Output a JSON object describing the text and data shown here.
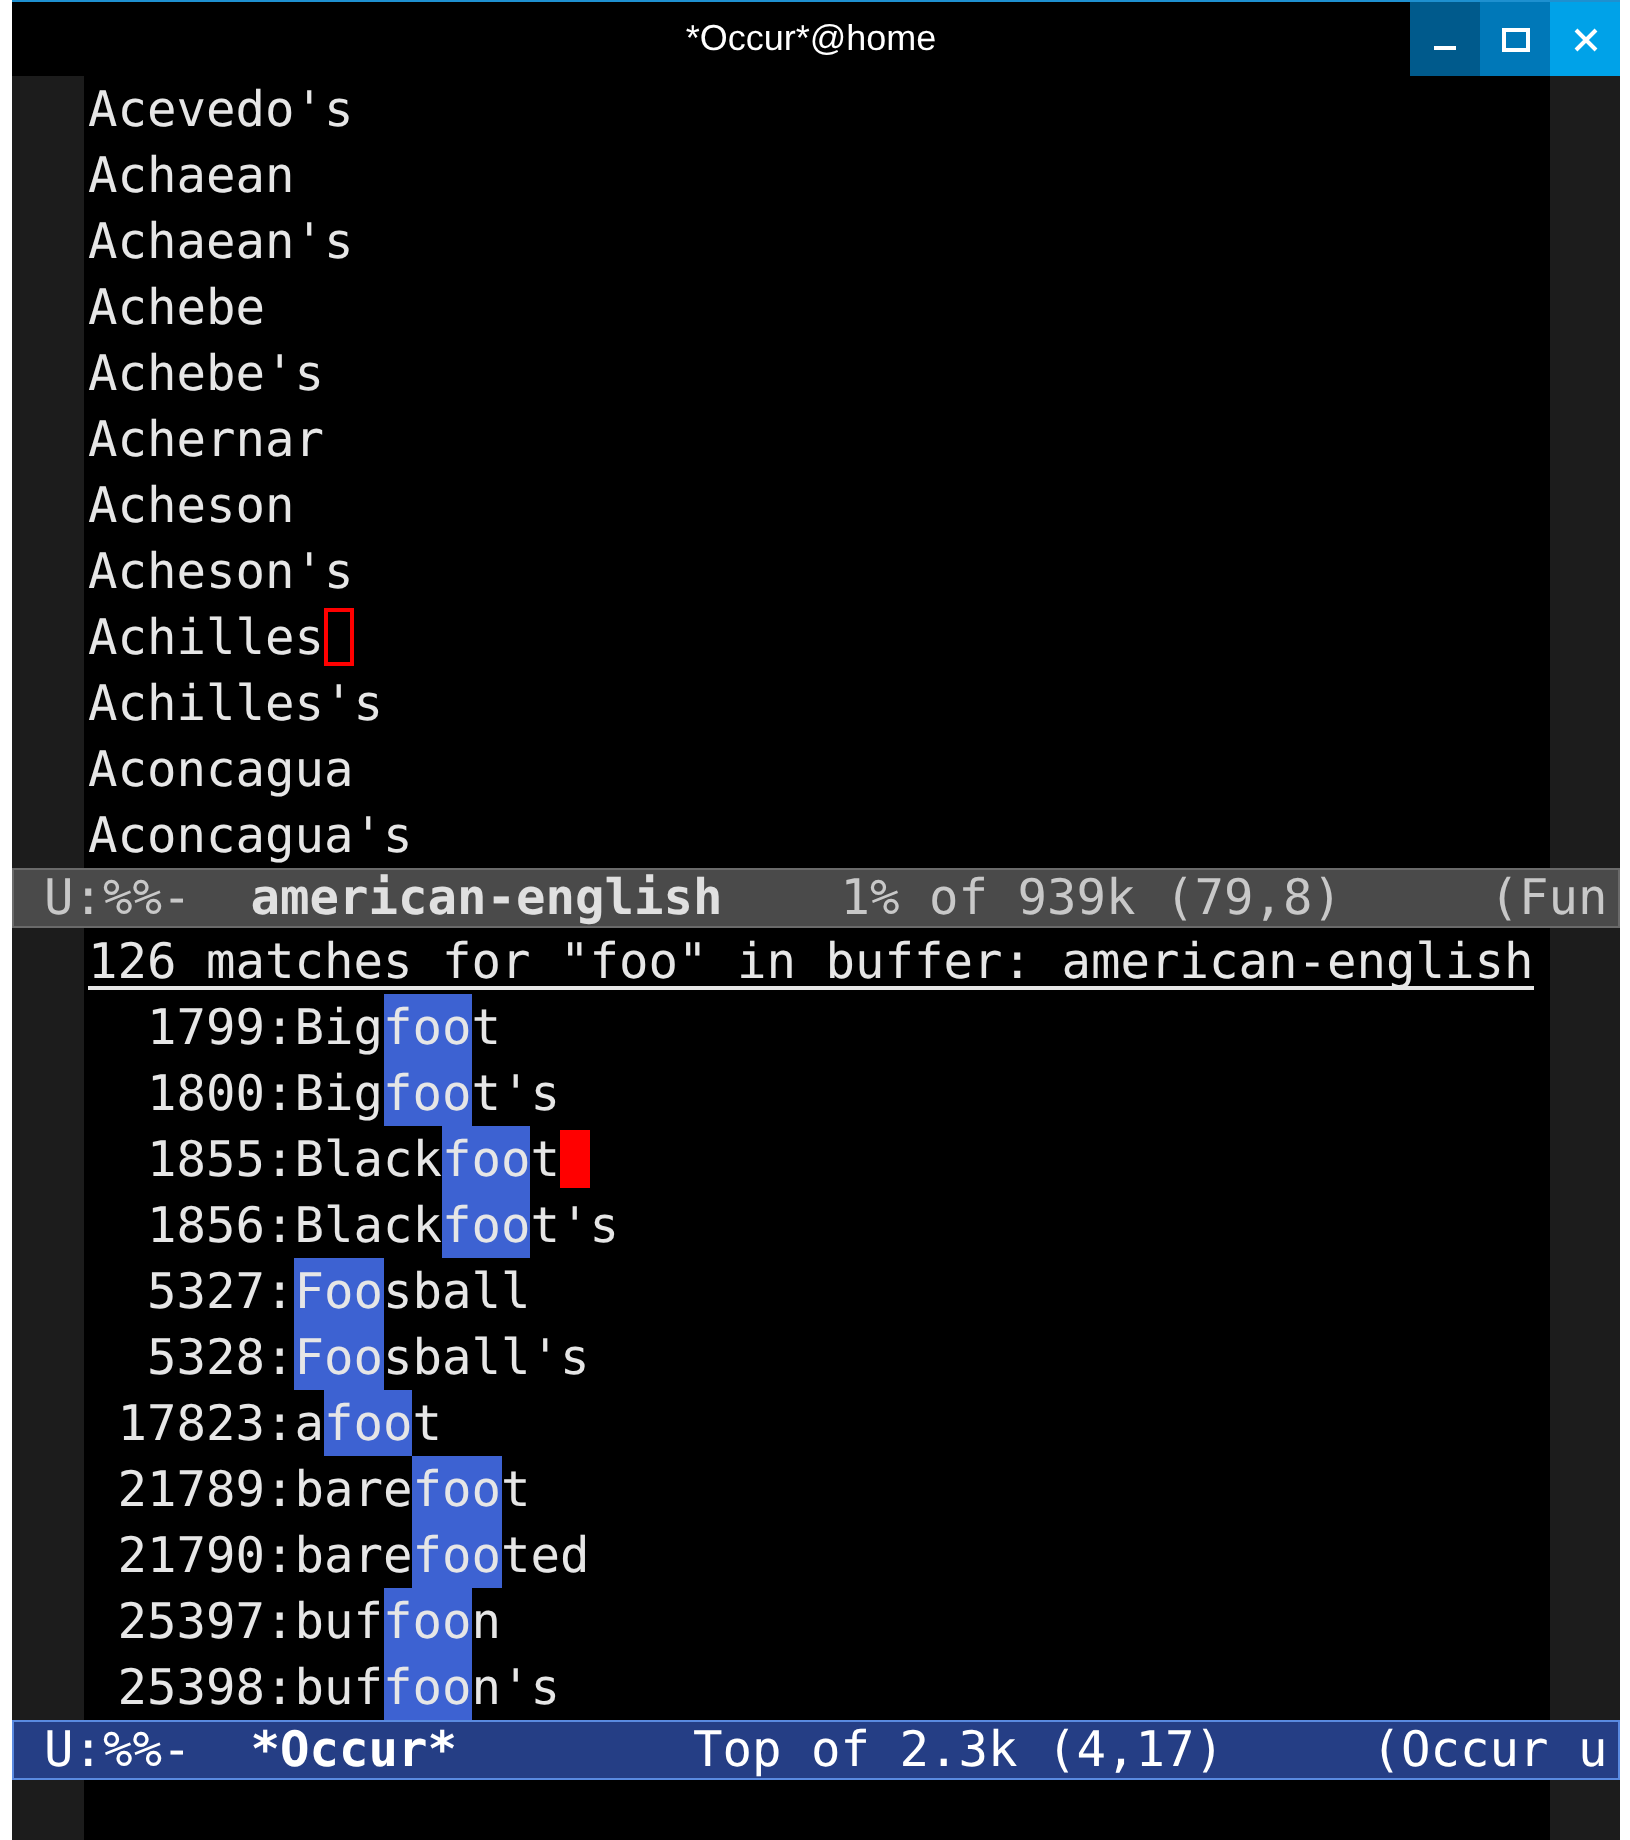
{
  "window": {
    "title": "*Occur*@home"
  },
  "upper_window": {
    "active": false,
    "lines": [
      {
        "text": "Acevedo's",
        "cursor": false
      },
      {
        "text": "Achaean",
        "cursor": false
      },
      {
        "text": "Achaean's",
        "cursor": false
      },
      {
        "text": "Achebe",
        "cursor": false
      },
      {
        "text": "Achebe's",
        "cursor": false
      },
      {
        "text": "Achernar",
        "cursor": false
      },
      {
        "text": "Acheson",
        "cursor": false
      },
      {
        "text": "Acheson's",
        "cursor": false
      },
      {
        "text": "Achilles",
        "cursor": true
      },
      {
        "text": "Achilles's",
        "cursor": false
      },
      {
        "text": "Aconcagua",
        "cursor": false
      },
      {
        "text": "Aconcagua's",
        "cursor": false
      }
    ],
    "mode_line": {
      "status": "U:%%-",
      "buffer": "american-english",
      "position": "1% of 939k (79,8)",
      "mode": "(Fun"
    }
  },
  "occur_window": {
    "active": true,
    "header": "126 matches for \"foo\" in buffer: american-english",
    "matches": [
      {
        "line": "1799:",
        "before": "Big",
        "match": "foo",
        "after": "t",
        "cursor": false
      },
      {
        "line": "1800:",
        "before": "Big",
        "match": "foo",
        "after": "t's",
        "cursor": false
      },
      {
        "line": "1855:",
        "before": "Black",
        "match": "foo",
        "after": "t",
        "cursor": true
      },
      {
        "line": "1856:",
        "before": "Black",
        "match": "foo",
        "after": "t's",
        "cursor": false
      },
      {
        "line": "5327:",
        "match": "Foo",
        "after": "sball",
        "cursor": false
      },
      {
        "line": "5328:",
        "match": "Foo",
        "after": "sball's",
        "cursor": false
      },
      {
        "line": "17823:",
        "before": "a",
        "match": "foo",
        "after": "t",
        "cursor": false
      },
      {
        "line": "21789:",
        "before": "bare",
        "match": "foo",
        "after": "t",
        "cursor": false
      },
      {
        "line": "21790:",
        "before": "bare",
        "match": "foo",
        "after": "ted",
        "cursor": false
      },
      {
        "line": "25397:",
        "before": "buf",
        "match": "foo",
        "after": "n",
        "cursor": false
      },
      {
        "line": "25398:",
        "before": "buf",
        "match": "foo",
        "after": "n's",
        "cursor": false
      }
    ],
    "mode_line": {
      "status": "U:%%-",
      "buffer": "*Occur*",
      "position": "Top of 2.3k (4,17)",
      "mode": "(Occur u"
    }
  }
}
